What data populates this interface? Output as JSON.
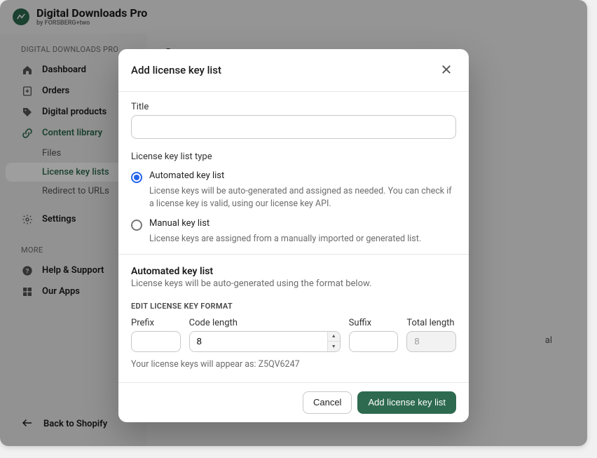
{
  "brand": {
    "title": "Digital Downloads Pro",
    "subtitle": "by FORSBERG+two"
  },
  "sidebar": {
    "section1_label": "DIGITAL DOWNLOADS PRO",
    "items": {
      "dashboard": "Dashboard",
      "orders": "Orders",
      "digital_products": "Digital products",
      "content_library": "Content library",
      "files": "Files",
      "license_key_lists": "License key lists",
      "redirect_urls": "Redirect to URLs",
      "settings": "Settings"
    },
    "section2_label": "MORE",
    "more": {
      "help": "Help & Support",
      "our_apps": "Our Apps"
    },
    "back": "Back to Shopify"
  },
  "main": {
    "heading_fragment": "Co",
    "trailing_char": "al"
  },
  "modal": {
    "title": "Add license key list",
    "title_label": "Title",
    "title_value": "",
    "type_label": "License key list type",
    "options": {
      "automated": {
        "label": "Automated key list",
        "desc": "License keys will be auto-generated and assigned as needed. You can check if a license key is valid, using our license key API."
      },
      "manual": {
        "label": "Manual key list",
        "desc": "License keys are assigned from a manually imported or generated list."
      }
    },
    "auto_section": {
      "title": "Automated key list",
      "desc": "License keys will be auto-generated using the format below.",
      "format_label": "EDIT LICENSE KEY FORMAT",
      "prefix_label": "Prefix",
      "prefix_value": "",
      "codelen_label": "Code length",
      "codelen_value": "8",
      "suffix_label": "Suffix",
      "suffix_value": "",
      "total_label": "Total length",
      "total_value": "8",
      "preview": "Your license keys will appear as: Z5QV6247"
    },
    "footer": {
      "cancel": "Cancel",
      "submit": "Add license key list"
    }
  }
}
